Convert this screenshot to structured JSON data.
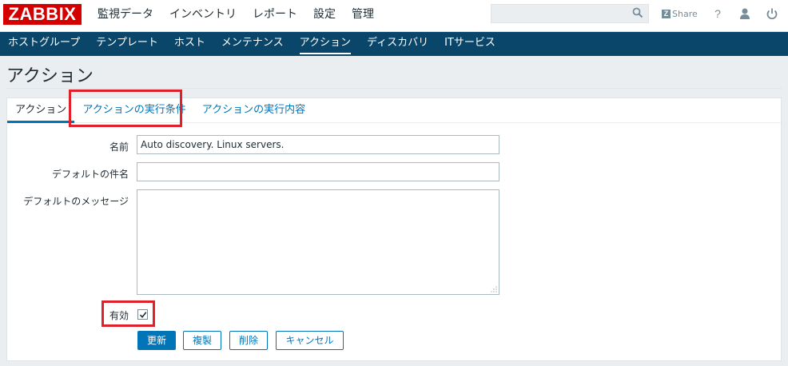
{
  "header": {
    "logo": "ZABBIX",
    "menu": [
      "監視データ",
      "インベントリ",
      "レポート",
      "設定",
      "管理"
    ],
    "active_menu": "設定",
    "search": {
      "value": "",
      "placeholder": ""
    },
    "share_label": "Share",
    "icons": [
      "search-icon",
      "help-icon",
      "user-icon",
      "power-icon"
    ]
  },
  "submenu": {
    "items": [
      "ホストグループ",
      "テンプレート",
      "ホスト",
      "メンテナンス",
      "アクション",
      "ディスカバリ",
      "ITサービス"
    ],
    "active": "アクション"
  },
  "page": {
    "title": "アクション"
  },
  "tabs": [
    {
      "label": "アクション",
      "active": true
    },
    {
      "label": "アクションの実行条件",
      "active": false
    },
    {
      "label": "アクションの実行内容",
      "active": false
    }
  ],
  "form": {
    "name_label": "名前",
    "name_value": "Auto discovery. Linux servers.",
    "subject_label": "デフォルトの件名",
    "subject_value": "",
    "message_label": "デフォルトのメッセージ",
    "message_value": "",
    "enabled_label": "有効",
    "enabled": true
  },
  "buttons": {
    "update": "更新",
    "clone": "複製",
    "delete": "削除",
    "cancel": "キャンセル"
  },
  "colors": {
    "brand_red": "#d40000",
    "submenu_bg": "#0a466a",
    "accent_blue": "#0275b8",
    "highlight_red": "#e0202a"
  }
}
